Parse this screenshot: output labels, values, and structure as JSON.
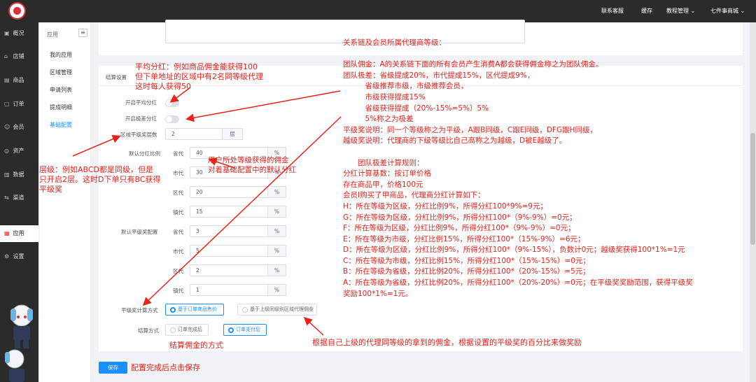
{
  "topbar": {
    "links": [
      "联系客服",
      "缓存",
      "教程管理 ⌄",
      "七件事商城 ⌄"
    ]
  },
  "leftnav": {
    "items": [
      {
        "label": "概况",
        "icon": "dashboard-icon"
      },
      {
        "label": "店铺",
        "icon": "store-icon"
      },
      {
        "label": "商品",
        "icon": "goods-icon"
      },
      {
        "label": "订单",
        "icon": "order-icon"
      },
      {
        "label": "会员",
        "icon": "member-icon"
      },
      {
        "label": "资产",
        "icon": "asset-icon"
      },
      {
        "label": "数据",
        "icon": "data-icon"
      },
      {
        "label": "渠道",
        "icon": "channel-icon"
      },
      {
        "label": "应用",
        "icon": "apps-icon"
      },
      {
        "label": "设置",
        "icon": "settings-icon"
      }
    ]
  },
  "subnav": {
    "title": "应用",
    "items": [
      "我的应用",
      "区域管理",
      "申请列表",
      "提成明细",
      "基础配置"
    ]
  },
  "form": {
    "section_title": "结算设置",
    "avg_bonus_label": "开启平均分红",
    "diff_bonus_label": "开启极差分红",
    "peer_levels_label": "区域平级奖层数",
    "peer_levels_value": "2",
    "peer_levels_unit": "层",
    "default_ratio_label": "默认分红比例",
    "default_peer_label": "默认平级奖配置",
    "ratio_rows": [
      {
        "label": "省代",
        "value": "40",
        "unit": "%"
      },
      {
        "label": "市代",
        "value": "30",
        "unit": "%"
      },
      {
        "label": "区代",
        "value": "20",
        "unit": "%"
      },
      {
        "label": "镇代",
        "value": "15",
        "unit": "%"
      }
    ],
    "peer_rows": [
      {
        "label": "省代",
        "value": "3",
        "unit": "%"
      },
      {
        "label": "市代",
        "value": "5",
        "unit": "%"
      },
      {
        "label": "区代",
        "value": "2",
        "unit": "%"
      },
      {
        "label": "镇代",
        "value": "1",
        "unit": "%"
      }
    ],
    "peer_calc_label": "平级奖计算方式",
    "peer_calc_options": [
      "基于订单商品售价",
      "基于上级同级别区域代理佣金"
    ],
    "settle_label": "结算方式",
    "settle_options": [
      "订单完成后",
      "订单支付后"
    ],
    "save_label": "保存"
  },
  "annotations": {
    "avg": [
      "平均分红：例如商品佣金能获得100",
      "但下单地址的区域中有2名同等级代理",
      "这时每人获得50"
    ],
    "level": [
      "层级：例如ABCD都是同级，但是",
      "只开启2层。这时D下单只有BC获得",
      "平级奖"
    ],
    "commission": [
      "用户所处等级获得的佣金",
      "对着基础配置中的默认分红"
    ],
    "settle": "结算佣金的方式",
    "peer_calc": "根据自己上级的代理同等级的拿到的佣金，根据设置的平级奖的百分比来做奖励",
    "save": "配置完成后点击保存",
    "right": [
      "关系链及会员所属代理商等级：",
      "",
      "团队佣金：A的关系链下面的所有会员产生消费A都会获得佣金称之为团队佣金。",
      "团队极差：省级提成20%，市代提成15%，区代提成9%，",
      "　　　省级推荐市级，市级推荐会员，",
      "　　　市级获得提成15%",
      "　　　省级获得提成（20%-15%=5%）5%",
      "　　　5%称之为极差",
      "平级奖说明：同一个等级称之为平级，A跟B同级，C跟E同级，DFG跟H同级，",
      "越级奖说明：代理商的下级等级比自己高称之为越级，D被E越级了。",
      "",
      "　　团队极差计算规则：",
      "分红计算基数：按订单价格",
      "存在商品甲，价格100元",
      "会员I购买了甲商品，代理商分红计算如下：",
      "H：所在等级为区级，分红比例9%，所得分红100*9%=9元；",
      "G：所在等级为区级，分红比例9%，所得分红100*（9%-9%）=0元；",
      "F：所在等级为区级，分红比例9%，所得分红100*（9%-9%）=0元；",
      "E：所在等级为市级，分红比例15%，所得分红100*（15%-9%）=6元；",
      "D：所在等级为区级，分红比例9%，所得分红100*（9%-15%），负数计0元；越级奖获得100*1%=1元",
      "C：所在等级为市级，分红比例15%，所得分红100*（15%-15%）=0元；",
      "B：所在等级为省级，分红比例20%，所得分红100*（20%-15%）=5元；",
      "A：所在等级为省级，分红比例20%，所得分红100*（20%-20%）=0元；在平级奖奖励范围，获得平级奖",
      "奖励100*1%=1元。"
    ]
  },
  "colors": {
    "accent": "#1890ff",
    "annotation": "#e8211a",
    "nav_bg": "#2b2b2b"
  }
}
